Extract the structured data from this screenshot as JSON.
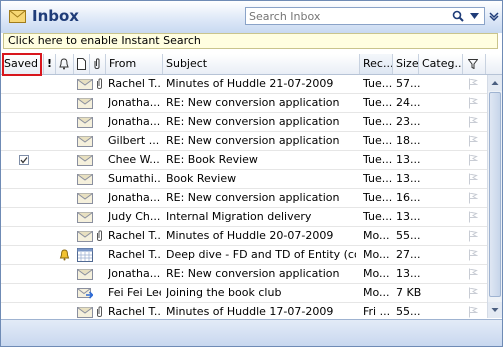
{
  "header": {
    "title": "Inbox"
  },
  "search": {
    "placeholder": "Search Inbox"
  },
  "instant_search": {
    "text": "Click here to enable Instant Search"
  },
  "columns": {
    "saved": "Saved",
    "importance": "!",
    "from": "From",
    "subject": "Subject",
    "received": "Rec...",
    "size": "Size",
    "categories": "Categ..."
  },
  "messages": [
    {
      "from": "Rachel T...",
      "subject": "Minutes of Huddle 21-07-2009",
      "received": "Tue...",
      "size": "57...",
      "attachment": true,
      "saved": false,
      "reminder": false,
      "icon": "envelope-icon",
      "icon_type": "calendar"
    },
    {
      "from": "Jonatha...",
      "subject": "RE: New conversion application",
      "received": "Tue...",
      "size": "24...",
      "attachment": false,
      "saved": false,
      "reminder": false,
      "icon": "envelope-icon"
    },
    {
      "from": "Jonatha...",
      "subject": "RE: New conversion application",
      "received": "Tue...",
      "size": "23...",
      "attachment": false,
      "saved": false,
      "reminder": false,
      "icon": "envelope-icon"
    },
    {
      "from": "Gilbert ...",
      "subject": "RE: New conversion application",
      "received": "Tue...",
      "size": "18...",
      "attachment": false,
      "saved": false,
      "reminder": false,
      "icon": "envelope-icon"
    },
    {
      "from": "Chee W...",
      "subject": "RE: Book Review",
      "received": "Tue...",
      "size": "13...",
      "attachment": false,
      "saved": true,
      "reminder": false,
      "icon": "envelope-icon"
    },
    {
      "from": "Sumathi...",
      "subject": "Book Review",
      "received": "Tue...",
      "size": "13...",
      "attachment": false,
      "saved": false,
      "reminder": false,
      "icon": "envelope-icon"
    },
    {
      "from": "Jonatha...",
      "subject": "RE: New conversion application",
      "received": "Tue...",
      "size": "16...",
      "attachment": false,
      "saved": false,
      "reminder": false,
      "icon": "envelope-icon"
    },
    {
      "from": "Judy Ch...",
      "subject": "Internal Migration delivery",
      "received": "Tue...",
      "size": "13...",
      "attachment": false,
      "saved": false,
      "reminder": false,
      "icon": "envelope-icon"
    },
    {
      "from": "Rachel T...",
      "subject": "Minutes of Huddle 20-07-2009",
      "received": "Mo...",
      "size": "55...",
      "attachment": true,
      "saved": false,
      "reminder": false,
      "icon": "envelope-icon"
    },
    {
      "from": "Rachel T...",
      "subject": "Deep dive - FD and TD of Entity (co...",
      "received": "Mo...",
      "size": "27...",
      "attachment": false,
      "saved": false,
      "reminder": true,
      "icon": "calendar-icon"
    },
    {
      "from": "Jonatha...",
      "subject": "RE: New conversion application",
      "received": "Mo...",
      "size": "13...",
      "attachment": false,
      "saved": false,
      "reminder": false,
      "icon": "envelope-icon"
    },
    {
      "from": "Fei Fei Lee",
      "subject": "Joining the book club",
      "received": "Mo...",
      "size": "7 KB",
      "attachment": false,
      "saved": false,
      "reminder": false,
      "icon": "forwarded-envelope-icon"
    },
    {
      "from": "Rachel T...",
      "subject": "Minutes of Huddle 17-07-2009",
      "received": "Fri ...",
      "size": "55...",
      "attachment": true,
      "saved": false,
      "reminder": false,
      "icon": "envelope-icon"
    }
  ]
}
